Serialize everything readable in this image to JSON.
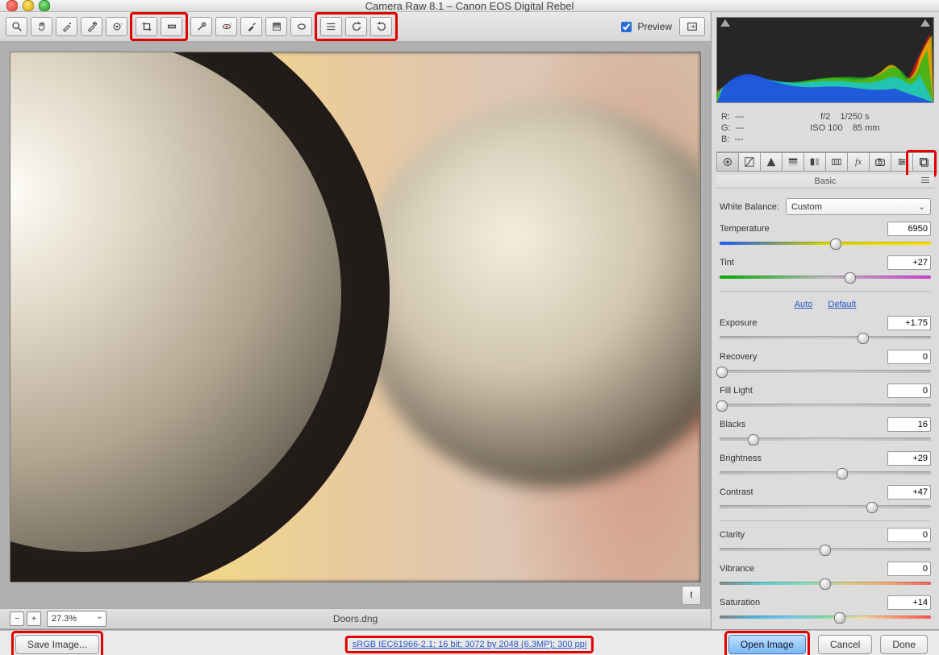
{
  "title": "Camera Raw 8.1  –  Canon EOS Digital Rebel",
  "toolbar": {
    "preview_label": "Preview"
  },
  "zoom": {
    "level": "27.3%"
  },
  "filename": "Doors.dng",
  "histogram": {
    "rgb": {
      "r": "---",
      "g": "---",
      "b": "---"
    },
    "exif": {
      "aperture": "f/2",
      "shutter": "1/250 s",
      "iso": "ISO 100",
      "focal": "85 mm"
    }
  },
  "panel": {
    "name": "Basic",
    "white_balance_label": "White Balance:",
    "white_balance_value": "Custom",
    "auto": "Auto",
    "default": "Default",
    "sliders": {
      "temperature": {
        "label": "Temperature",
        "value": "6950",
        "pos": 55
      },
      "tint": {
        "label": "Tint",
        "value": "+27",
        "pos": 62
      },
      "exposure": {
        "label": "Exposure",
        "value": "+1.75",
        "pos": 68
      },
      "recovery": {
        "label": "Recovery",
        "value": "0",
        "pos": 1
      },
      "filllight": {
        "label": "Fill Light",
        "value": "0",
        "pos": 1
      },
      "blacks": {
        "label": "Blacks",
        "value": "16",
        "pos": 16
      },
      "brightness": {
        "label": "Brightness",
        "value": "+29",
        "pos": 58
      },
      "contrast": {
        "label": "Contrast",
        "value": "+47",
        "pos": 72
      },
      "clarity": {
        "label": "Clarity",
        "value": "0",
        "pos": 50
      },
      "vibrance": {
        "label": "Vibrance",
        "value": "0",
        "pos": 50
      },
      "saturation": {
        "label": "Saturation",
        "value": "+14",
        "pos": 57
      }
    }
  },
  "footer": {
    "save": "Save Image...",
    "workflow": "sRGB IEC61966-2.1; 16 bit; 3072 by 2048 (6.3MP); 300 ppi",
    "open": "Open Image",
    "cancel": "Cancel",
    "done": "Done"
  }
}
